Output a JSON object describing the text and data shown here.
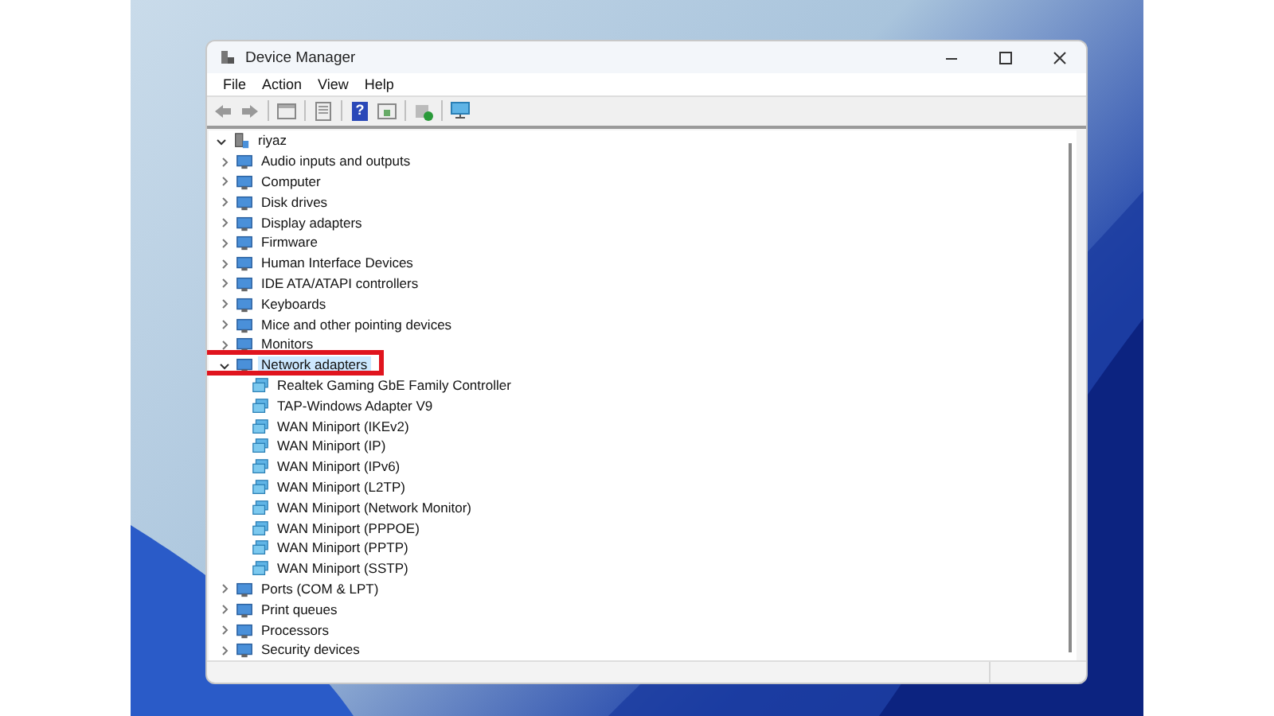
{
  "window": {
    "title": "Device Manager"
  },
  "menu": [
    "File",
    "Action",
    "View",
    "Help"
  ],
  "toolbar": {
    "help_glyph": "?"
  },
  "tree": {
    "label": "riyaz",
    "expanded": true,
    "children": [
      {
        "label": "Audio inputs and outputs",
        "expanded": false,
        "selected": false
      },
      {
        "label": "Computer",
        "expanded": false,
        "selected": false
      },
      {
        "label": "Disk drives",
        "expanded": false,
        "selected": false
      },
      {
        "label": "Display adapters",
        "expanded": false,
        "selected": false
      },
      {
        "label": "Firmware",
        "expanded": false,
        "selected": false
      },
      {
        "label": "Human Interface Devices",
        "expanded": false,
        "selected": false
      },
      {
        "label": "IDE ATA/ATAPI controllers",
        "expanded": false,
        "selected": false
      },
      {
        "label": "Keyboards",
        "expanded": false,
        "selected": false
      },
      {
        "label": "Mice and other pointing devices",
        "expanded": false,
        "selected": false
      },
      {
        "label": "Monitors",
        "expanded": false,
        "selected": false
      },
      {
        "label": "Network adapters",
        "expanded": true,
        "selected": true,
        "highlighted": true,
        "children": [
          {
            "label": "Realtek Gaming GbE Family Controller"
          },
          {
            "label": "TAP-Windows Adapter V9"
          },
          {
            "label": "WAN Miniport (IKEv2)"
          },
          {
            "label": "WAN Miniport (IP)"
          },
          {
            "label": "WAN Miniport (IPv6)"
          },
          {
            "label": "WAN Miniport (L2TP)"
          },
          {
            "label": "WAN Miniport (Network Monitor)"
          },
          {
            "label": "WAN Miniport (PPPOE)"
          },
          {
            "label": "WAN Miniport (PPTP)"
          },
          {
            "label": "WAN Miniport (SSTP)"
          }
        ]
      },
      {
        "label": "Ports (COM & LPT)",
        "expanded": false,
        "selected": false
      },
      {
        "label": "Print queues",
        "expanded": false,
        "selected": false
      },
      {
        "label": "Processors",
        "expanded": false,
        "selected": false
      },
      {
        "label": "Security devices",
        "expanded": false,
        "selected": false
      }
    ]
  }
}
